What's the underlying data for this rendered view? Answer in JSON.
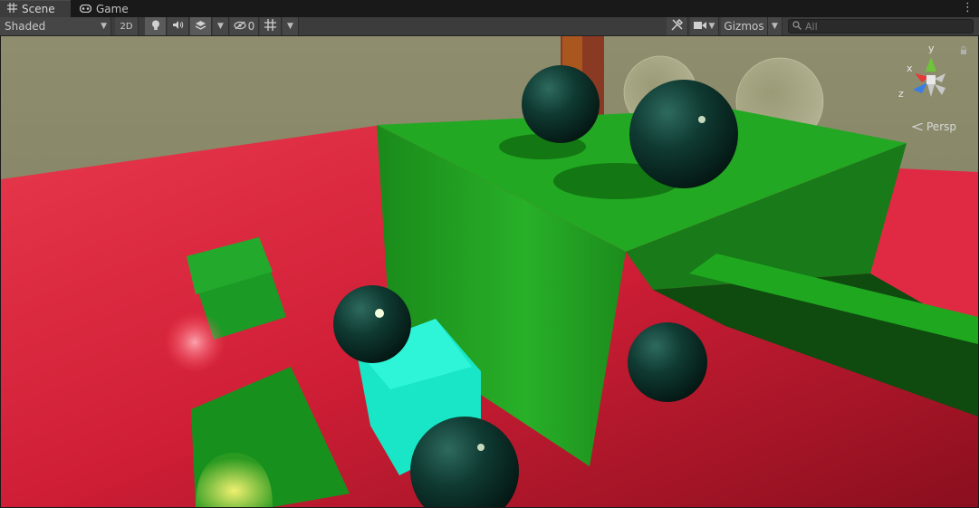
{
  "tabs": [
    {
      "label": "Scene",
      "icon": "grid-icon",
      "active": true
    },
    {
      "label": "Game",
      "icon": "gamepad-icon",
      "active": false
    }
  ],
  "toolbar": {
    "draw_mode": "Shaded",
    "mode_2d": "2D",
    "hidden_count": "0",
    "gizmos_label": "Gizmos",
    "search_placeholder": "All"
  },
  "orientation_gizmo": {
    "axis_y": "y",
    "axis_x": "x",
    "axis_z": "z",
    "projection": "Persp",
    "colors": {
      "x": "#e53a3a",
      "y": "#6ec43a",
      "z": "#3a7de5"
    }
  },
  "scene": {
    "colors": {
      "sky": "#8a8a6a",
      "floor": "#e0283e",
      "green_box": "#1fa01f",
      "cyan_cube": "#18e8c8",
      "sphere": "#0d2e28"
    }
  }
}
